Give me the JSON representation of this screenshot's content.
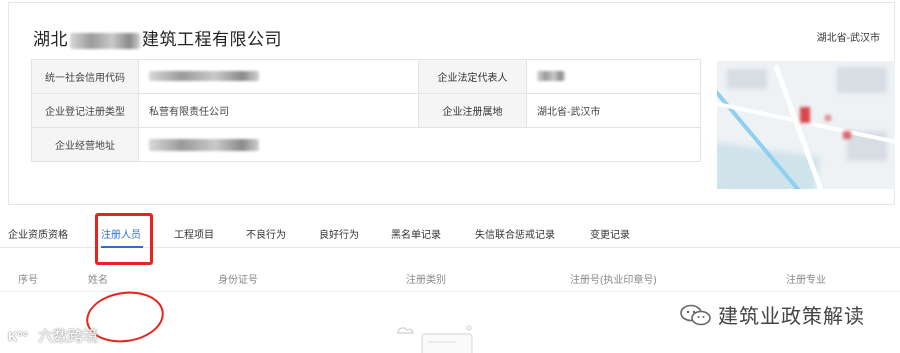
{
  "company": {
    "name_prefix": "湖北",
    "name_suffix": "建筑工程有限公司",
    "location": "湖北省-武汉市"
  },
  "info_table": {
    "rows": [
      {
        "label_left": "统一社会信用代码",
        "label_right": "企业法定代表人"
      },
      {
        "label_left": "企业登记注册类型",
        "value_left": "私营有限责任公司",
        "label_right": "企业注册属地",
        "value_right": "湖北省-武汉市"
      },
      {
        "label_left": "企业经营地址"
      }
    ]
  },
  "tabs": [
    {
      "label": "企业资质资格"
    },
    {
      "label": "注册人员"
    },
    {
      "label": "工程项目"
    },
    {
      "label": "不良行为"
    },
    {
      "label": "良好行为"
    },
    {
      "label": "黑名单记录"
    },
    {
      "label": "失信联合惩戒记录"
    },
    {
      "label": "变更记录"
    }
  ],
  "active_tab": "注册人员",
  "table_headers": [
    "序号",
    "姓名",
    "身份证号",
    "注册类别",
    "注册号(执业印章号)",
    "注册专业"
  ],
  "watermarks": {
    "left_logo": "K°°",
    "left_text": "六数跨境",
    "right_text": "建筑业政策解读"
  },
  "colors": {
    "accent": "#2b6fd6",
    "annotation_red": "#e8221c"
  }
}
